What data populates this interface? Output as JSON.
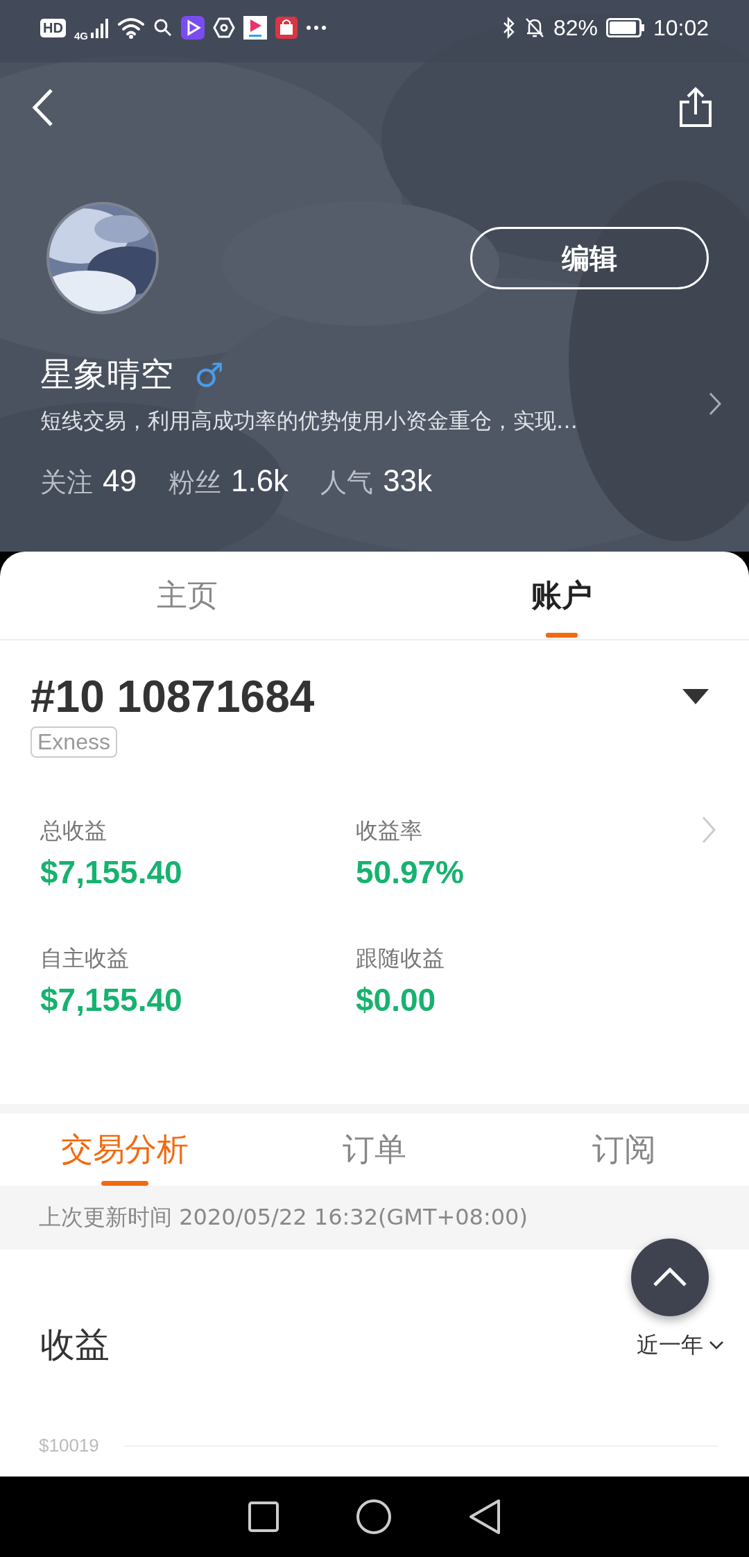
{
  "status_bar": {
    "hd_badge": "HD",
    "network": "4G",
    "battery": "82%",
    "time": "10:02"
  },
  "profile": {
    "name": "星象晴空",
    "gender_symbol": "♂",
    "bio": "短线交易，利用高成功率的优势使用小资金重仓，实现…",
    "edit_button": "编辑",
    "stats": [
      {
        "label": "关注",
        "value": "49"
      },
      {
        "label": "粉丝",
        "value": "1.6k"
      },
      {
        "label": "人气",
        "value": "33k"
      }
    ]
  },
  "tabs": [
    {
      "label": "主页",
      "selected": false
    },
    {
      "label": "账户",
      "selected": true
    }
  ],
  "account": {
    "number": "#10 10871684",
    "broker": "Exness",
    "metrics": [
      {
        "label": "总收益",
        "value": "$7,155.40"
      },
      {
        "label": "收益率",
        "value": "50.97%"
      },
      {
        "label": "自主收益",
        "value": "$7,155.40"
      },
      {
        "label": "跟随收益",
        "value": "$0.00"
      }
    ]
  },
  "sub_tabs": [
    {
      "label": "交易分析",
      "selected": true
    },
    {
      "label": "订单",
      "selected": false
    },
    {
      "label": "订阅",
      "selected": false
    }
  ],
  "last_updated": "上次更新时间 2020/05/22 16:32(GMT+08:00)",
  "earnings": {
    "title": "收益",
    "period": "近一年",
    "y_tick": "$10019"
  }
}
